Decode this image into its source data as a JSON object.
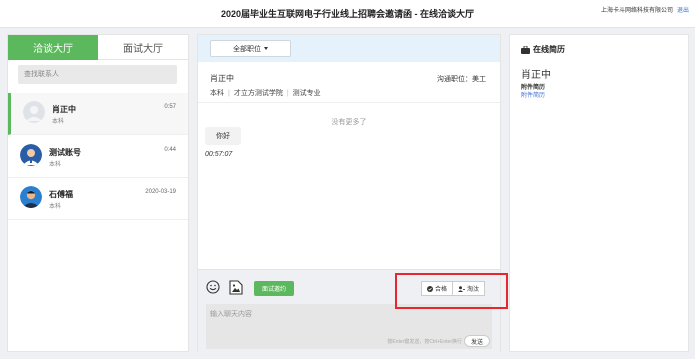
{
  "header": {
    "title": "2020届毕业生互联网电子行业线上招聘会邀请函 - 在线洽谈大厅",
    "company": "上海卡斗网络科技有限公司",
    "logout": "退出"
  },
  "sidebar": {
    "tabs": [
      {
        "label": "洽谈大厅",
        "active": true
      },
      {
        "label": "面试大厅",
        "active": false
      }
    ],
    "search_placeholder": "查找联系人",
    "contacts": [
      {
        "name": "肖正中",
        "degree": "本科",
        "time": "0:57",
        "selected": true
      },
      {
        "name": "测试账号",
        "degree": "本科",
        "time": "0:44",
        "selected": false
      },
      {
        "name": "石傅福",
        "degree": "本科",
        "time": "2020-03-19",
        "selected": false
      }
    ]
  },
  "chat": {
    "position_filter": "全部职位",
    "candidate": {
      "name": "肖正中",
      "position_label": "沟通职位：美工",
      "degree": "本科",
      "school": "才立方测试学院",
      "major": "测试专业"
    },
    "no_more": "没有更多了",
    "messages": [
      {
        "text": "你好",
        "time": "00:57:07"
      }
    ],
    "composer": {
      "interview_button": "面试邀约",
      "pass_button": "合格",
      "reject_button": "淘汰",
      "input_placeholder": "输入聊天内容",
      "hint": "按Enter键发送，按Ctrl+Enter换行",
      "send_button": "发送"
    }
  },
  "resume": {
    "heading": "在线简历",
    "name": "肖正中",
    "attachment_label": "附件简历",
    "attachment_link": "附件简历"
  },
  "colors": {
    "accent_green": "#5cb85c",
    "header_blue": "#e6f2fb",
    "link_blue": "#3a6fd8",
    "highlight_red": "#e8262d"
  }
}
